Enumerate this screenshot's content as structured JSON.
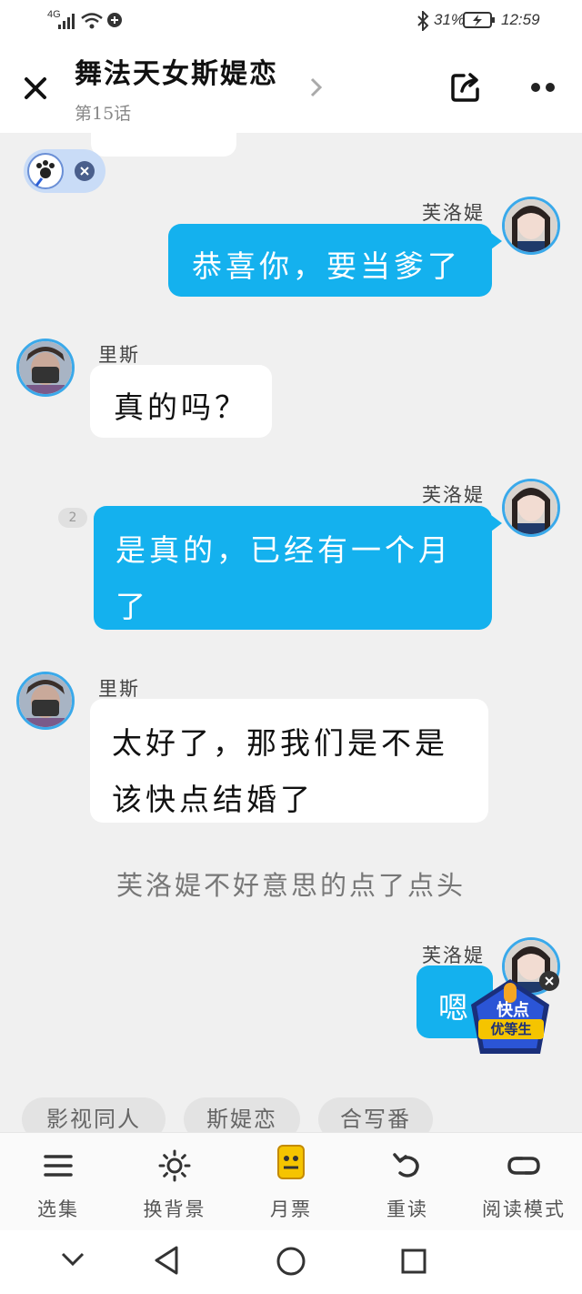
{
  "status_bar": {
    "network": "4G",
    "battery_percent": "31%",
    "time": "12:59"
  },
  "header": {
    "title": "舞法天女斯媞恋",
    "chapter": "第15话"
  },
  "messages": [
    {
      "side": "right",
      "speaker": "芙洛媞",
      "text": "恭喜你，要当爹了"
    },
    {
      "side": "left",
      "speaker": "里斯",
      "text": "真的吗？"
    },
    {
      "side": "right",
      "speaker": "芙洛媞",
      "text_line1": "是真的，已经有一个月",
      "text_line2": "了",
      "comment_count": "2"
    },
    {
      "side": "left",
      "speaker": "里斯",
      "text_line1": "太好了，那我们是不是",
      "text_line2": "该快点结婚了"
    },
    {
      "side": "right",
      "speaker": "芙洛媞",
      "text": "嗯"
    }
  ],
  "narration": "芙洛媞不好意思的点了点头",
  "promo_badge": {
    "line1": "快点",
    "line2": "优等生"
  },
  "tags": [
    "影视同人",
    "斯媞恋",
    "合写番"
  ],
  "toolbar": {
    "items": [
      {
        "label": "选集",
        "icon": "menu-icon"
      },
      {
        "label": "换背景",
        "icon": "sun-icon"
      },
      {
        "label": "月票",
        "icon": "ticket-icon"
      },
      {
        "label": "重读",
        "icon": "undo-icon"
      },
      {
        "label": "阅读模式",
        "icon": "loop-icon"
      }
    ]
  },
  "colors": {
    "bubble_blue": "#14b1ee",
    "avatar_ring": "#3aa9ea",
    "background": "#f0f0f0"
  }
}
